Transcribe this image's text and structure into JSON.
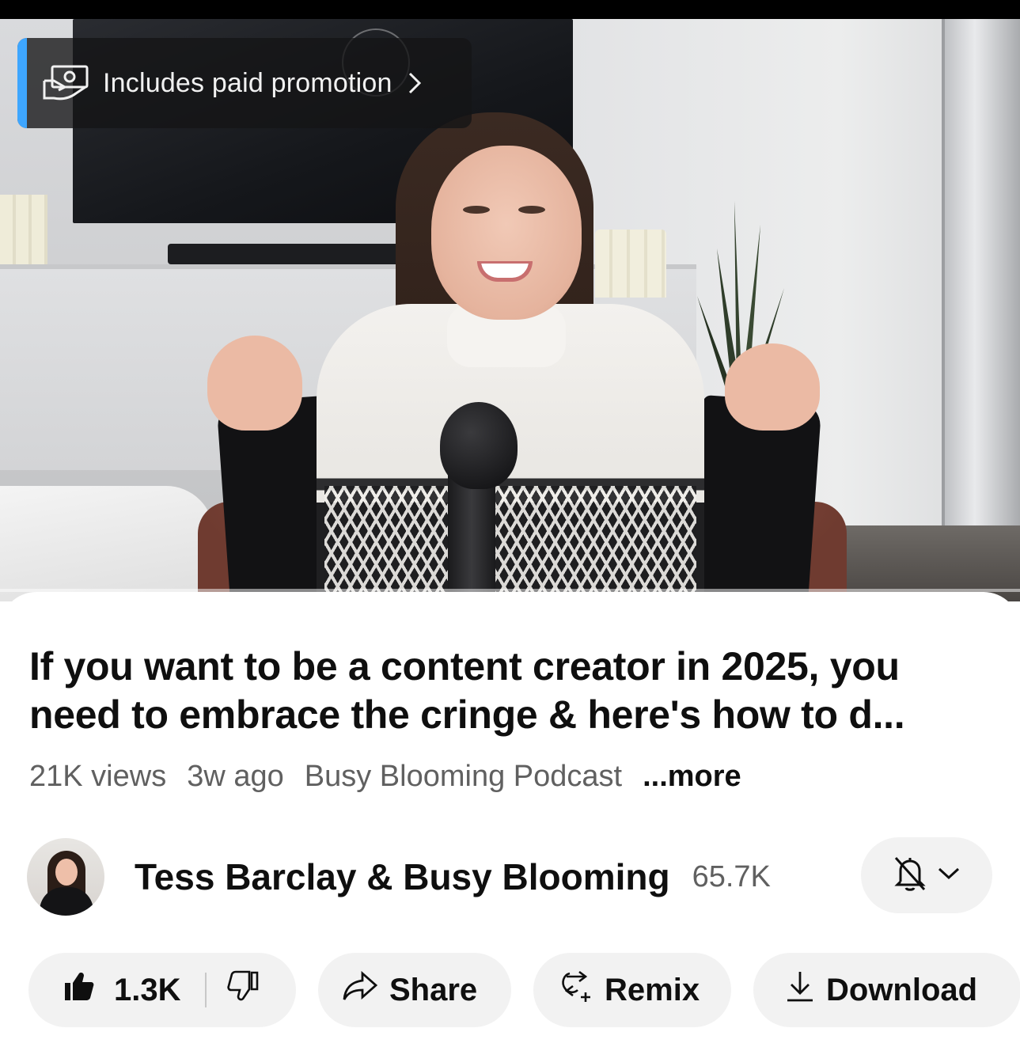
{
  "promotion": {
    "label": "Includes paid promotion",
    "accent_color": "#3ea6ff",
    "icon": "paid-promotion-icon",
    "chevron_icon": "chevron-right-icon"
  },
  "video": {
    "title": "If you want to be a content creator in 2025, you need to embrace the cringe & here's how to d...",
    "views": "21K views",
    "age": "3w ago",
    "channel_tag": "Busy Blooming Podcast",
    "more_label": "...more"
  },
  "channel": {
    "name": "Tess Barclay & Busy Blooming",
    "subscribers": "65.7K",
    "bell_icon": "bell-off-icon",
    "dropdown_icon": "chevron-down-icon"
  },
  "actions": {
    "like_count": "1.3K",
    "like_icon": "thumbs-up-filled-icon",
    "dislike_icon": "thumbs-down-icon",
    "share_label": "Share",
    "share_icon": "share-arrow-icon",
    "remix_label": "Remix",
    "remix_icon": "remix-icon",
    "download_label": "Download",
    "download_icon": "download-icon"
  }
}
